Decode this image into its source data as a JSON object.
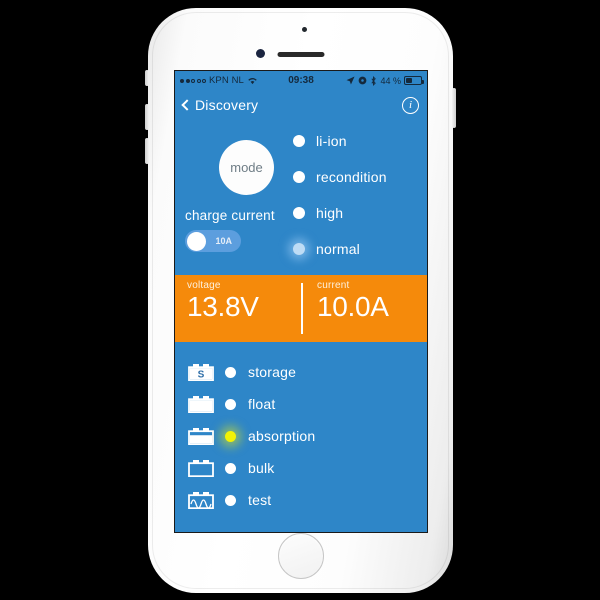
{
  "status_bar": {
    "signal_dots_filled": 2,
    "signal_dots_total": 5,
    "carrier": "KPN NL",
    "wifi_icon": "wifi-icon",
    "time": "09:38",
    "location_icon": "location-arrow-icon",
    "rotation_lock_icon": "rotation-lock-icon",
    "bluetooth_icon": "bluetooth-icon",
    "battery_percent": "44 %",
    "battery_level": 44
  },
  "nav_bar": {
    "back_icon": "chevron-left-icon",
    "back_label": "Discovery",
    "info_icon": "info-icon",
    "info_glyph": "i"
  },
  "mode_section": {
    "mode_button_label": "mode",
    "options": [
      {
        "label": "li-ion",
        "selected": false
      },
      {
        "label": "recondition",
        "selected": false
      },
      {
        "label": "high",
        "selected": false
      },
      {
        "label": "normal",
        "selected": true
      }
    ],
    "charge_current": {
      "title": "charge current",
      "toggle_value": "10A",
      "toggle_on": false
    }
  },
  "readout": {
    "voltage_label": "voltage",
    "voltage_value": "13.8V",
    "current_label": "current",
    "current_value": "10.0A"
  },
  "status_list": {
    "rows": [
      {
        "label": "storage",
        "icon": "battery-storage-icon",
        "fill": 0,
        "badge": "S",
        "active": false
      },
      {
        "label": "float",
        "icon": "battery-full-icon",
        "fill": 100,
        "badge": "",
        "active": false
      },
      {
        "label": "absorption",
        "icon": "battery-absorption-icon",
        "fill": 72,
        "badge": "",
        "active": true
      },
      {
        "label": "bulk",
        "icon": "battery-empty-icon",
        "fill": 0,
        "badge": "",
        "active": false
      },
      {
        "label": "test",
        "icon": "battery-test-icon",
        "fill": 0,
        "badge": "",
        "active": false
      }
    ]
  },
  "colors": {
    "screen_blue": "#2e86c8",
    "readout_orange": "#f58a0b",
    "active_led_yellow": "#f2f205",
    "selected_radio_blue": "#bedcf5",
    "toggle_track": "#5c9ede"
  },
  "device": {
    "home_button": "home-button",
    "speaker": "earpiece-speaker",
    "front_camera": "front-camera"
  }
}
